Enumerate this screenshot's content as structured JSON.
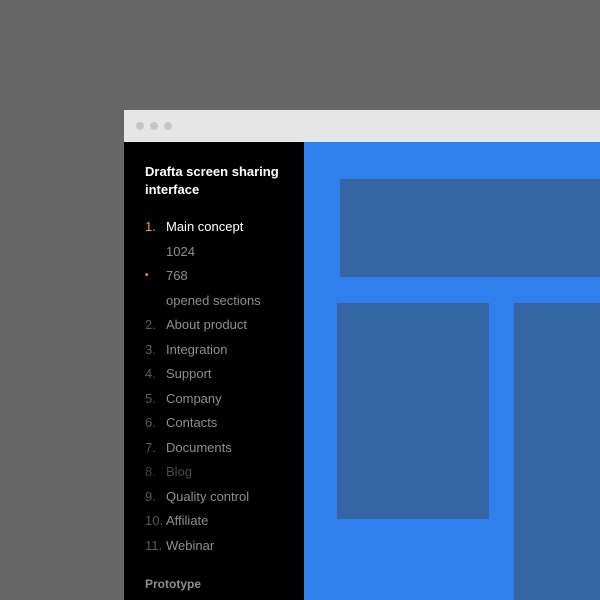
{
  "sidebar": {
    "title": "Drafta screen sharing interface",
    "items": [
      {
        "num": "1.",
        "label": "Main concept",
        "state": "active"
      },
      {
        "num": "",
        "label": "1024",
        "state": "sub"
      },
      {
        "num": "•",
        "label": "768",
        "state": "sub-current"
      },
      {
        "num": "",
        "label": "opened sections",
        "state": "sub"
      },
      {
        "num": "2.",
        "label": "About product",
        "state": "normal"
      },
      {
        "num": "3.",
        "label": "Integration",
        "state": "normal"
      },
      {
        "num": "4.",
        "label": "Support",
        "state": "normal"
      },
      {
        "num": "5.",
        "label": "Company",
        "state": "normal"
      },
      {
        "num": "6.",
        "label": "Contacts",
        "state": "normal"
      },
      {
        "num": "7.",
        "label": "Documents",
        "state": "normal"
      },
      {
        "num": "8.",
        "label": "Blog",
        "state": "muted"
      },
      {
        "num": "9.",
        "label": "Quality control",
        "state": "normal"
      },
      {
        "num": "10.",
        "label": "Affiliate",
        "state": "normal"
      },
      {
        "num": "11.",
        "label": "Webinar",
        "state": "normal"
      }
    ],
    "section_heading": "Prototype"
  },
  "colors": {
    "background": "#666666",
    "titlebar": "#e6e6e6",
    "sidebar": "#000000",
    "accent": "#f5a623",
    "content": "#2f80ed",
    "placeholder_block": "#3565a2"
  }
}
